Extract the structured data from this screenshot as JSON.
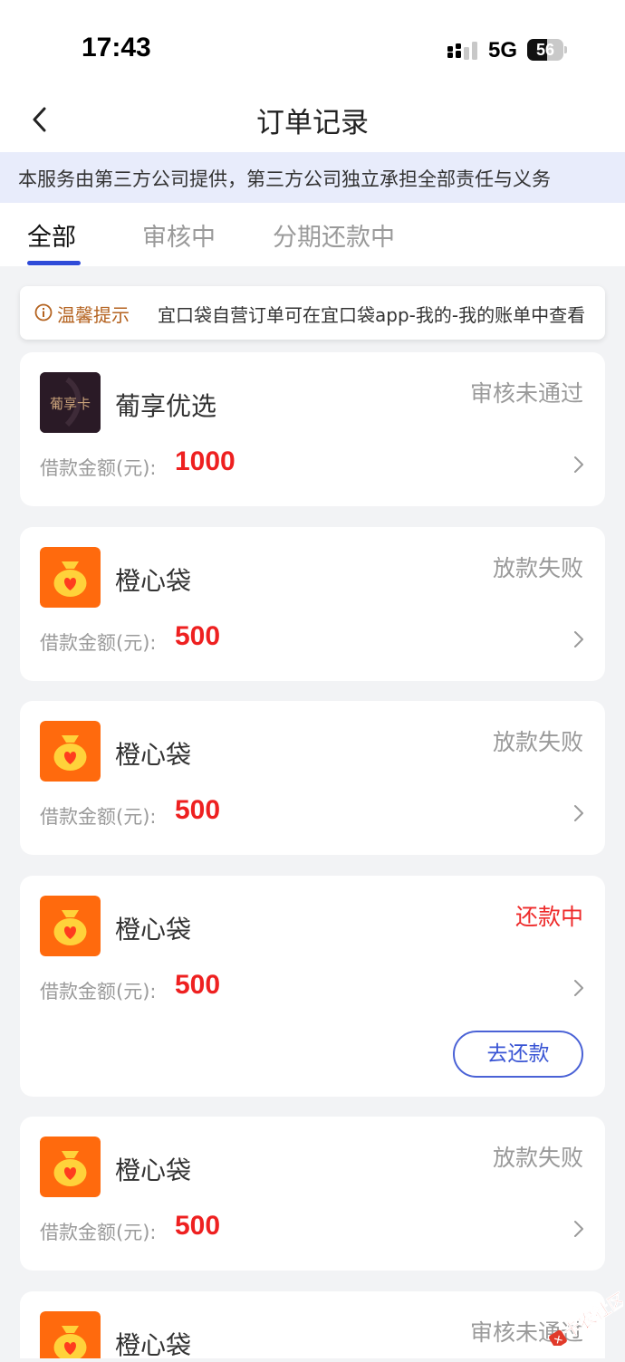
{
  "status_bar": {
    "time": "17:43",
    "network": "5G",
    "battery": "56",
    "battery_level": 0.56
  },
  "nav": {
    "title": "订单记录"
  },
  "notice": {
    "text": "本服务由第三方公司提供，第三方公司独立承担全部责任与义务"
  },
  "tabs": [
    {
      "label": "全部",
      "active": true
    },
    {
      "label": "审核中",
      "active": false
    },
    {
      "label": "分期还款中",
      "active": false
    }
  ],
  "tip": {
    "label": "温馨提示",
    "text": "宜口袋自营订单可在宜口袋app-我的-我的账单中查看"
  },
  "orders": [
    {
      "name": "葡享优选",
      "logo_text": "葡享卡",
      "status": "审核未通过",
      "amount_label": "借款金额(元):",
      "amount": "1000"
    },
    {
      "name": "橙心袋",
      "status": "放款失败",
      "amount_label": "借款金额(元):",
      "amount": "500"
    },
    {
      "name": "橙心袋",
      "status": "放款失败",
      "amount_label": "借款金额(元):",
      "amount": "500"
    },
    {
      "name": "橙心袋",
      "status": "还款中",
      "amount_label": "借款金额(元):",
      "amount": "500",
      "action_label": "去还款"
    },
    {
      "name": "橙心袋",
      "status": "放款失败",
      "amount_label": "借款金额(元):",
      "amount": "500"
    },
    {
      "name": "橙心袋",
      "status": "审核未通过"
    }
  ],
  "watermark": {
    "text": "卡农社区"
  },
  "colors": {
    "accent_blue": "#2f4bd8",
    "amount_red": "#ee2020",
    "status_gray": "#9a9a9a",
    "notice_bg": "#e8ecfb",
    "tip_orange": "#b4621f",
    "logo_orange": "#ff6a0d"
  }
}
